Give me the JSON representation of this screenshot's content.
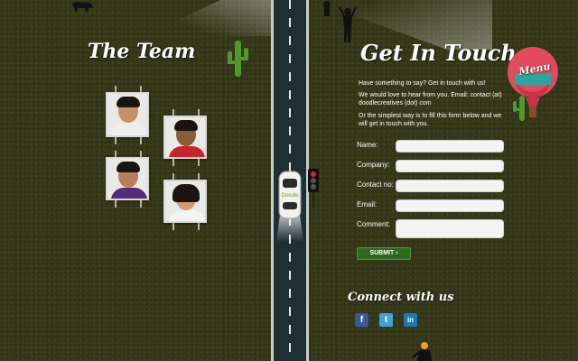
{
  "team": {
    "title": "The Team"
  },
  "contact": {
    "title": "Get In Touch",
    "intro": "Have something to say? Get in touch with us!",
    "email_line": "We would love to hear from you. Email: contact (at) doodlecreatives (dot) com",
    "form_line": "Or the simplest way is to fill this form below and we will get in touch with you.",
    "fields": {
      "name_label": "Name:",
      "company_label": "Company:",
      "contact_label": "Contact no:",
      "email_label": "Email:",
      "comment_label": "Comment:"
    },
    "submit_label": "SUBMIT ›"
  },
  "connect": {
    "title": "Connect with us",
    "facebook": "f",
    "twitter": "t",
    "linkedin": "in"
  },
  "balloon": {
    "label": "Menu"
  },
  "colors": {
    "background": "#37391b",
    "road": "#1f2f33",
    "submit": "#2e6b1e",
    "balloon": "#e24b5f"
  }
}
